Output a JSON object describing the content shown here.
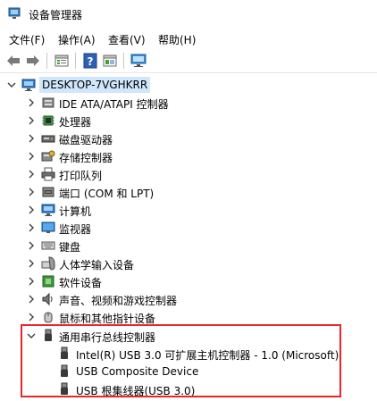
{
  "window": {
    "title": "设备管理器"
  },
  "menu": [
    "文件(F)",
    "操作(A)",
    "查看(V)",
    "帮助(H)"
  ],
  "toolbar": [
    "back-icon",
    "forward-icon",
    "properties-icon",
    "help-icon",
    "view-icon",
    "scan-hardware-icon"
  ],
  "tree": {
    "root": "DESKTOP-7VGHKRR",
    "categories": [
      "IDE ATA/ATAPI 控制器",
      "处理器",
      "磁盘驱动器",
      "存储控制器",
      "打印队列",
      "端口 (COM 和 LPT)",
      "计算机",
      "监视器",
      "键盘",
      "人体学输入设备",
      "软件设备",
      "声音、视频和游戏控制器",
      "鼠标和其他指针设备"
    ],
    "expanded": {
      "label": "通用串行总线控制器",
      "children": [
        "Intel(R) USB 3.0 可扩展主机控制器 - 1.0 (Microsoft)",
        "USB Composite Device",
        "USB 根集线器(USB 3.0)"
      ]
    }
  },
  "colors": {
    "highlight_border": "#e8262d",
    "selection": "#cfe6fb"
  }
}
